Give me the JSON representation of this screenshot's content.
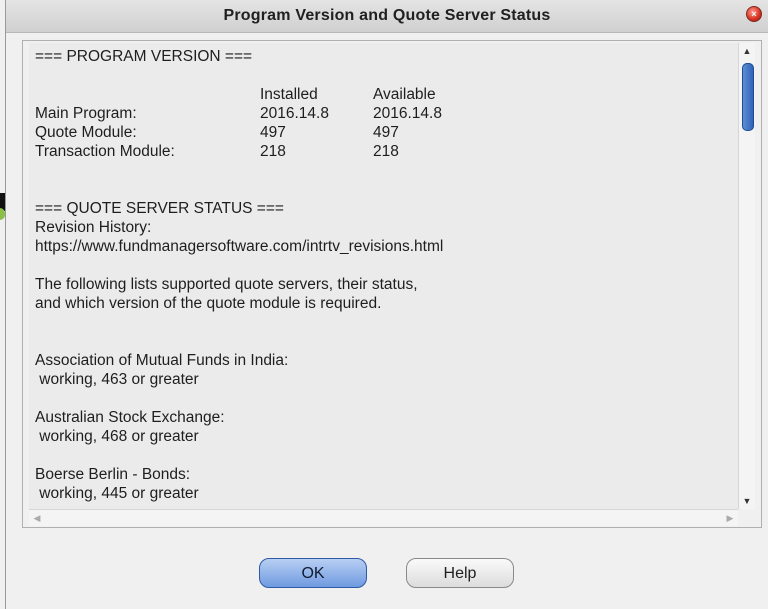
{
  "window": {
    "title": "Program Version and Quote Server Status",
    "close_icon": "close-icon"
  },
  "content": {
    "program_version_header": "=== PROGRAM VERSION ===",
    "col_installed": "Installed",
    "col_available": "Available",
    "versions": [
      {
        "label": "Main Program:",
        "installed": "2016.14.8",
        "available": "2016.14.8"
      },
      {
        "label": "Quote Module:",
        "installed": "497",
        "available": "497"
      },
      {
        "label": "Transaction Module:",
        "installed": "218",
        "available": "218"
      }
    ],
    "quote_server_header": "=== QUOTE SERVER STATUS ===",
    "revision_history_label": "Revision History:",
    "revision_history_url": "https://www.fundmanagersoftware.com/intrtv_revisions.html",
    "description_line1": "The following lists supported quote servers, their status,",
    "description_line2": "and which version of the quote module is required.",
    "servers": [
      {
        "name": "Association of Mutual Funds in India:",
        "status": " working, 463 or greater"
      },
      {
        "name": "Australian Stock Exchange:",
        "status": " working, 468 or greater"
      },
      {
        "name": "Boerse Berlin - Bonds:",
        "status": " working, 445 or greater"
      }
    ]
  },
  "scrollbars": {
    "up_icon": "▲",
    "down_icon": "▼",
    "left_icon": "◀",
    "right_icon": "▶"
  },
  "buttons": {
    "ok_label": "OK",
    "help_label": "Help"
  }
}
